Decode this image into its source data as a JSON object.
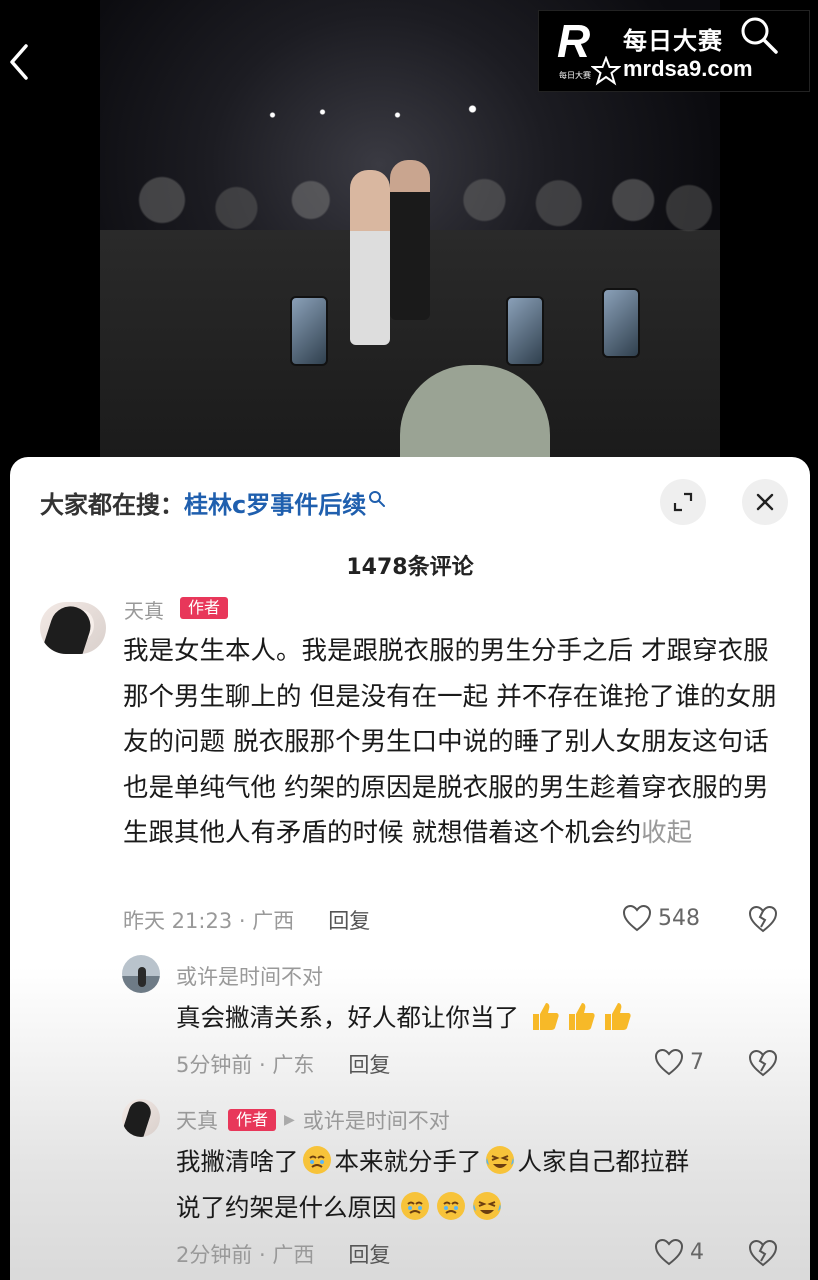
{
  "watermark": {
    "logo_letter": "R",
    "logo_sub": "每日大赛",
    "title": "每日大赛",
    "site": "mrdsa9.com"
  },
  "search": {
    "prefix": "大家都在搜：",
    "query": "桂林c罗事件后续"
  },
  "comments_header": {
    "count_label": "1478条评论"
  },
  "main_comment": {
    "author": "天真",
    "badge": "作者",
    "text": "我是女生本人。我是跟脱衣服的男生分手之后 才跟穿衣服那个男生聊上的 但是没有在一起 并不存在谁抢了谁的女朋友的问题 脱衣服那个男生口中说的睡了别人女朋友这句话 也是单纯气他 约架的原因是脱衣服的男生趁着穿衣服的男生跟其他人有矛盾的时候 就想借着这个机会约",
    "collapse": "收起",
    "time": "昨天 21:23 · 广西",
    "reply": "回复",
    "likes": "548"
  },
  "replies": [
    {
      "author": "或许是时间不对",
      "text": "真会撇清关系，好人都让你当了",
      "emojis": [
        "thumbs-up",
        "thumbs-up",
        "thumbs-up"
      ],
      "time": "5分钟前 · 广东",
      "reply": "回复",
      "likes": "7"
    },
    {
      "author": "天真",
      "badge": "作者",
      "reply_to": "或许是时间不对",
      "text_part1": "我撇清啥了",
      "text_part2": "本来就分手了",
      "text_part3": "人家自己都拉群",
      "text_part4": "说了约架是什么原因",
      "time": "2分钟前 · 广西",
      "reply": "回复",
      "likes": "4"
    }
  ]
}
